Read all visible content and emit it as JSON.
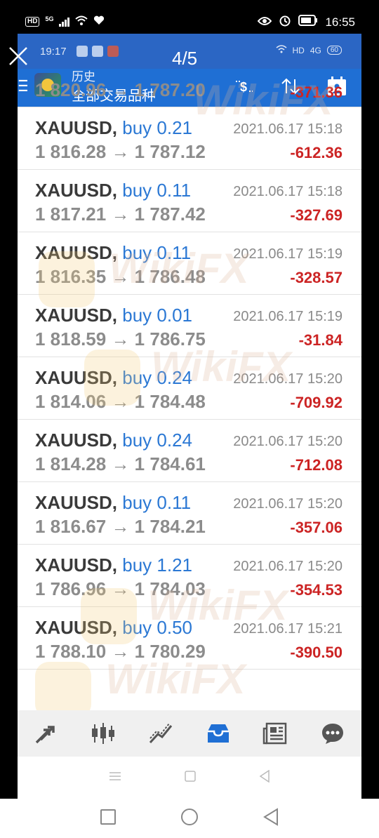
{
  "outer_status": {
    "time": "16:55",
    "network": "5G",
    "hd": "HD"
  },
  "viewer": {
    "counter": "4/5"
  },
  "inner_status": {
    "time": "19:17",
    "hd": "HD",
    "network": "4G",
    "battery": "60"
  },
  "app_bar": {
    "title": "历史",
    "subtitle": "全部交易品种"
  },
  "watermark": "WikiFX",
  "trades": [
    {
      "symbol": "",
      "side": "",
      "datetime": "",
      "open": "1 820.96",
      "close": "1 787.20",
      "profit": "-371.36"
    },
    {
      "symbol": "XAUUSD,",
      "side": "buy 0.21",
      "datetime": "2021.06.17 15:18",
      "open": "1 816.28",
      "close": "1 787.12",
      "profit": "-612.36"
    },
    {
      "symbol": "XAUUSD,",
      "side": "buy 0.11",
      "datetime": "2021.06.17 15:18",
      "open": "1 817.21",
      "close": "1 787.42",
      "profit": "-327.69"
    },
    {
      "symbol": "XAUUSD,",
      "side": "buy 0.11",
      "datetime": "2021.06.17 15:19",
      "open": "1 816.35",
      "close": "1 786.48",
      "profit": "-328.57"
    },
    {
      "symbol": "XAUUSD,",
      "side": "buy 0.01",
      "datetime": "2021.06.17 15:19",
      "open": "1 818.59",
      "close": "1 786.75",
      "profit": "-31.84"
    },
    {
      "symbol": "XAUUSD,",
      "side": "buy 0.24",
      "datetime": "2021.06.17 15:20",
      "open": "1 814.06",
      "close": "1 784.48",
      "profit": "-709.92"
    },
    {
      "symbol": "XAUUSD,",
      "side": "buy 0.24",
      "datetime": "2021.06.17 15:20",
      "open": "1 814.28",
      "close": "1 784.61",
      "profit": "-712.08"
    },
    {
      "symbol": "XAUUSD,",
      "side": "buy 0.11",
      "datetime": "2021.06.17 15:20",
      "open": "1 816.67",
      "close": "1 784.21",
      "profit": "-357.06"
    },
    {
      "symbol": "XAUUSD,",
      "side": "buy 1.21",
      "datetime": "2021.06.17 15:20",
      "open": "1 786.96",
      "close": "1 784.03",
      "profit": "-354.53"
    },
    {
      "symbol": "XAUUSD,",
      "side": "buy 0.50",
      "datetime": "2021.06.17 15:21",
      "open": "1 788.10",
      "close": "1 780.29",
      "profit": "-390.50"
    }
  ],
  "colors": {
    "app_bar": "#1f6fd4",
    "loss": "#cc2424",
    "side": "#2b78d4",
    "active_tab": "#1f6fd4"
  },
  "bottom_tabs": [
    {
      "icon": "trade-arrows-icon",
      "active": false
    },
    {
      "icon": "candlestick-icon",
      "active": false
    },
    {
      "icon": "line-chart-icon",
      "active": false
    },
    {
      "icon": "inbox-history-icon",
      "active": true
    },
    {
      "icon": "news-icon",
      "active": false
    },
    {
      "icon": "chat-icon",
      "active": false
    }
  ]
}
